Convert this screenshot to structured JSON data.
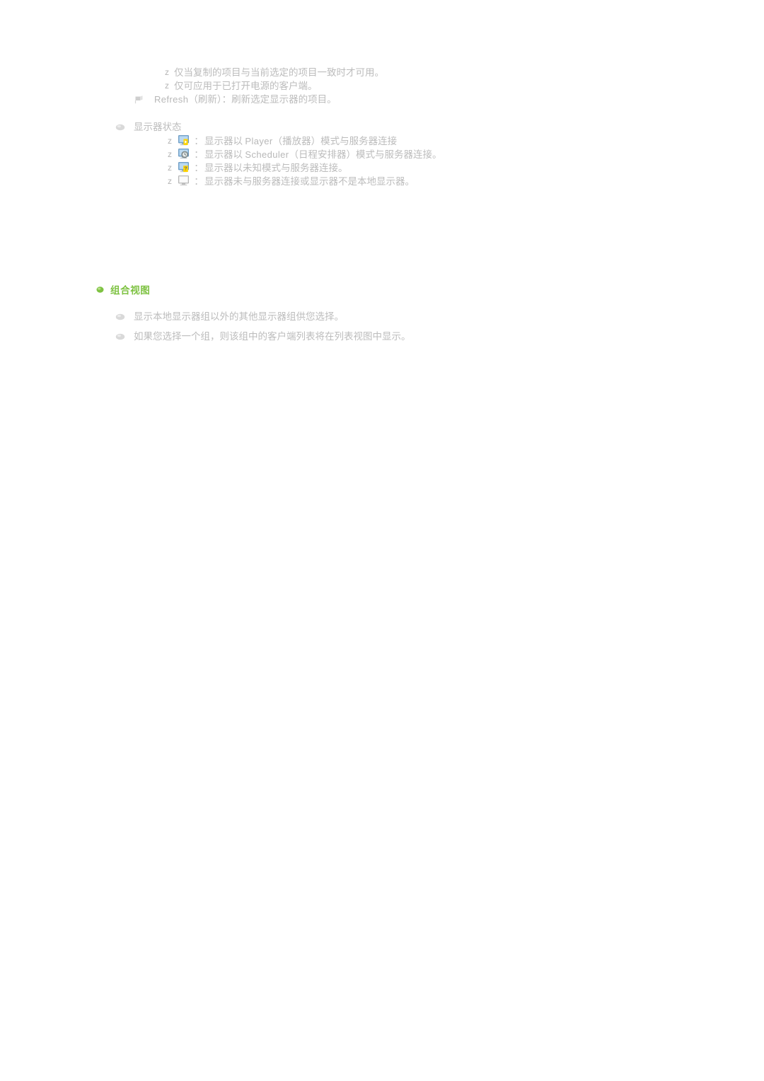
{
  "document": {
    "language": "zh-CN",
    "background_color": "#ffffff",
    "body_text_color": "#bcbcbc",
    "accent_green": "#7ec242"
  },
  "copy_notes": {
    "bullet_char": "z",
    "items": [
      "仅当复制的项目与当前选定的项目一致时才可用。",
      "仅可应用于已打开电源的客户端。"
    ]
  },
  "refresh_item": {
    "bullet_icon": "flag-bullet-icon",
    "label_latin": "Refresh",
    "label_rest": "（刷新）：刷新选定显示器的项目。"
  },
  "monitor_status": {
    "bullet_icon": "sphere-bullet-icon",
    "heading": "显示器状态",
    "bullet_char": "z",
    "colon": "：",
    "items": [
      {
        "icon": "monitor-player-mode-icon",
        "text_before": "显示器以",
        "latin": "Player",
        "text_after": "（播放器）模式与服务器连接"
      },
      {
        "icon": "monitor-scheduler-mode-icon",
        "text_before": "显示器以",
        "latin": "Scheduler",
        "text_after": "（日程安排器）模式与服务器连接。"
      },
      {
        "icon": "monitor-unknown-mode-icon",
        "text_before": "",
        "latin": "",
        "text_after": "显示器以未知模式与服务器连接。"
      },
      {
        "icon": "monitor-disconnected-icon",
        "text_before": "",
        "latin": "",
        "text_after": "显示器未与服务器连接或显示器不是本地显示器。"
      }
    ]
  },
  "group_view": {
    "bullet_icon": "green-sphere-bullet-icon",
    "heading": "组合视图",
    "item_bullet_icon": "sphere-bullet-icon",
    "items": [
      "显示本地显示器组以外的其他显示器组供您选择。",
      "如果您选择一个组，则该组中的客户端列表将在列表视图中显示。"
    ]
  }
}
